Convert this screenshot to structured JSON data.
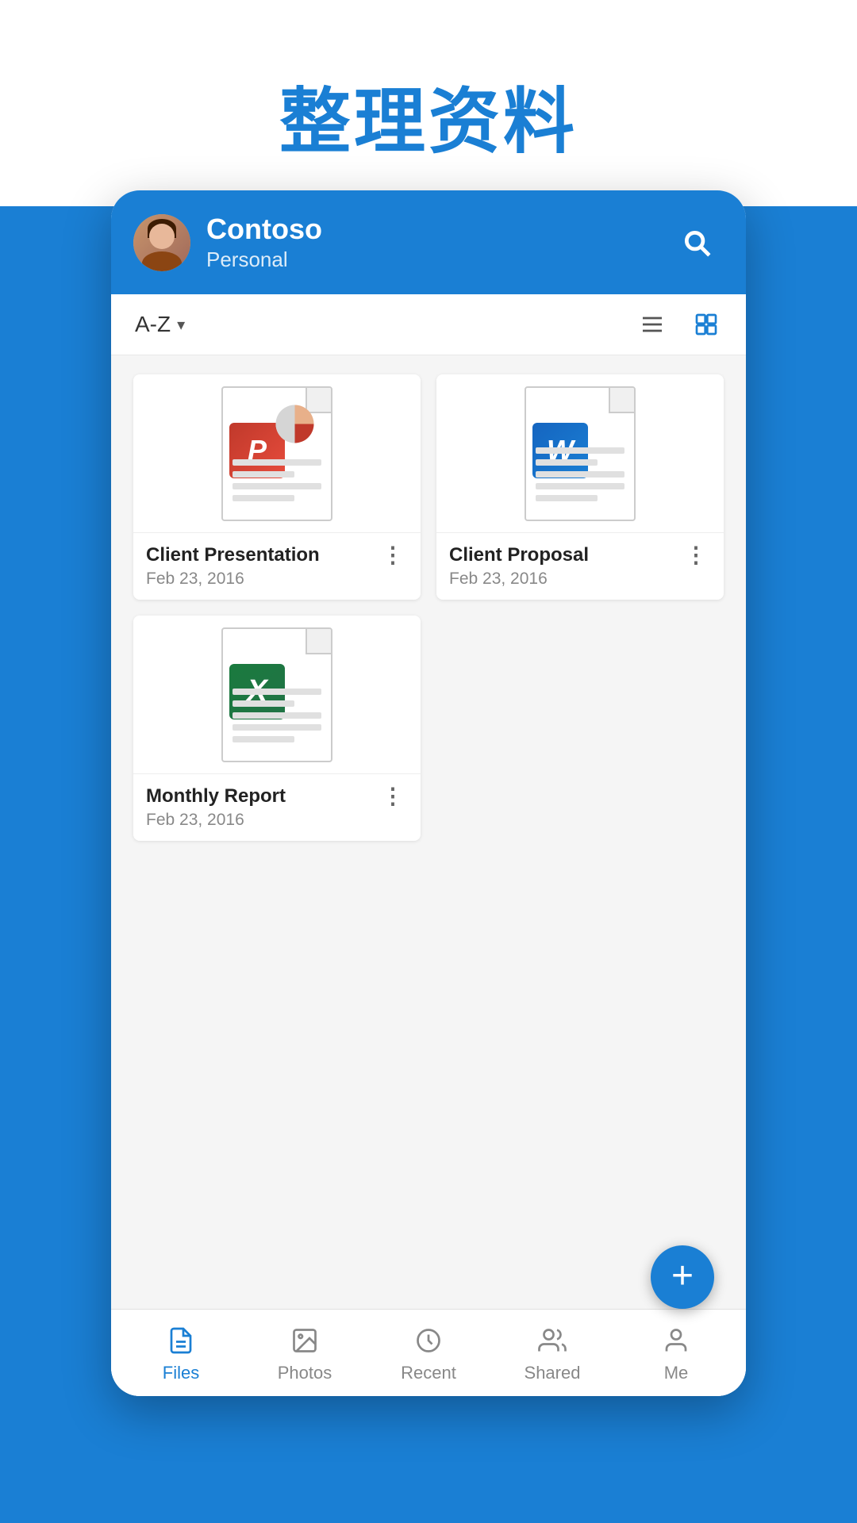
{
  "page": {
    "title": "整理资料",
    "background_color": "#1a7fd4"
  },
  "header": {
    "user_name": "Contoso",
    "user_sub": "Personal",
    "search_label": "Search"
  },
  "toolbar": {
    "sort_label": "A-Z",
    "sort_icon": "chevron-down",
    "list_view_label": "List view",
    "grid_view_label": "Grid view"
  },
  "files": [
    {
      "name": "Client Presentation",
      "date": "Feb 23, 2016",
      "type": "pptx",
      "app": "PowerPoint"
    },
    {
      "name": "Client Proposal",
      "date": "Feb 23, 2016",
      "type": "docx",
      "app": "Word"
    },
    {
      "name": "Monthly Report",
      "date": "Feb 23, 2016",
      "type": "xlsx",
      "app": "Excel"
    }
  ],
  "fab": {
    "label": "Add new file",
    "icon": "plus"
  },
  "nav": {
    "items": [
      {
        "id": "files",
        "label": "Files",
        "active": true
      },
      {
        "id": "photos",
        "label": "Photos",
        "active": false
      },
      {
        "id": "recent",
        "label": "Recent",
        "active": false
      },
      {
        "id": "shared",
        "label": "Shared",
        "active": false
      },
      {
        "id": "me",
        "label": "Me",
        "active": false
      }
    ]
  }
}
